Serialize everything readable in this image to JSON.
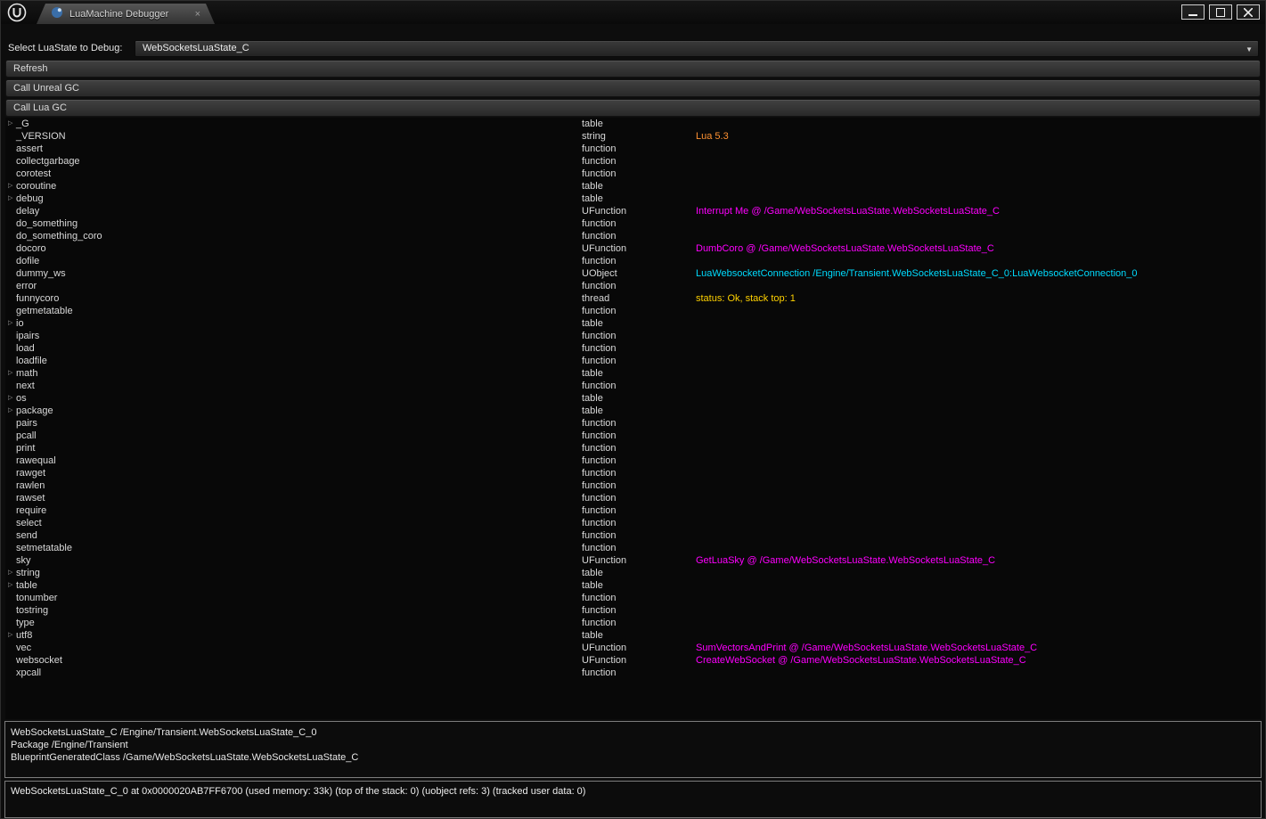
{
  "titlebar": {
    "tab_title": "LuaMachine Debugger"
  },
  "toolbar": {
    "select_label": "Select LuaState to Debug:",
    "selected_state": "WebSocketsLuaState_C",
    "buttons": [
      "Refresh",
      "Call Unreal GC",
      "Call Lua GC"
    ]
  },
  "icons": {
    "expander": "▷",
    "combo_arrow": "▼",
    "tab_close": "×"
  },
  "colors": {
    "string": "#ff9232",
    "ufunction": "#ff00ff",
    "uobject": "#00dcff",
    "thread": "#ffd200"
  },
  "tree": {
    "rows": [
      {
        "name": "_G",
        "type": "table",
        "expand": true
      },
      {
        "name": "_VERSION",
        "type": "string",
        "value": "Lua 5.3",
        "color": "string"
      },
      {
        "name": "assert",
        "type": "function"
      },
      {
        "name": "collectgarbage",
        "type": "function"
      },
      {
        "name": "corotest",
        "type": "function"
      },
      {
        "name": "coroutine",
        "type": "table",
        "expand": true
      },
      {
        "name": "debug",
        "type": "table",
        "expand": true
      },
      {
        "name": "delay",
        "type": "UFunction",
        "value": "Interrupt Me @ /Game/WebSocketsLuaState.WebSocketsLuaState_C",
        "color": "ufunction"
      },
      {
        "name": "do_something",
        "type": "function"
      },
      {
        "name": "do_something_coro",
        "type": "function"
      },
      {
        "name": "docoro",
        "type": "UFunction",
        "value": "DumbCoro @ /Game/WebSocketsLuaState.WebSocketsLuaState_C",
        "color": "ufunction"
      },
      {
        "name": "dofile",
        "type": "function"
      },
      {
        "name": "dummy_ws",
        "type": "UObject",
        "value": "LuaWebsocketConnection /Engine/Transient.WebSocketsLuaState_C_0:LuaWebsocketConnection_0",
        "color": "uobject"
      },
      {
        "name": "error",
        "type": "function"
      },
      {
        "name": "funnycoro",
        "type": "thread",
        "value": "status: Ok, stack top: 1",
        "color": "thread"
      },
      {
        "name": "getmetatable",
        "type": "function"
      },
      {
        "name": "io",
        "type": "table",
        "expand": true
      },
      {
        "name": "ipairs",
        "type": "function"
      },
      {
        "name": "load",
        "type": "function"
      },
      {
        "name": "loadfile",
        "type": "function"
      },
      {
        "name": "math",
        "type": "table",
        "expand": true
      },
      {
        "name": "next",
        "type": "function"
      },
      {
        "name": "os",
        "type": "table",
        "expand": true
      },
      {
        "name": "package",
        "type": "table",
        "expand": true
      },
      {
        "name": "pairs",
        "type": "function"
      },
      {
        "name": "pcall",
        "type": "function"
      },
      {
        "name": "print",
        "type": "function"
      },
      {
        "name": "rawequal",
        "type": "function"
      },
      {
        "name": "rawget",
        "type": "function"
      },
      {
        "name": "rawlen",
        "type": "function"
      },
      {
        "name": "rawset",
        "type": "function"
      },
      {
        "name": "require",
        "type": "function"
      },
      {
        "name": "select",
        "type": "function"
      },
      {
        "name": "send",
        "type": "function"
      },
      {
        "name": "setmetatable",
        "type": "function"
      },
      {
        "name": "sky",
        "type": "UFunction",
        "value": "GetLuaSky @ /Game/WebSocketsLuaState.WebSocketsLuaState_C",
        "color": "ufunction"
      },
      {
        "name": "string",
        "type": "table",
        "expand": true
      },
      {
        "name": "table",
        "type": "table",
        "expand": true
      },
      {
        "name": "tonumber",
        "type": "function"
      },
      {
        "name": "tostring",
        "type": "function"
      },
      {
        "name": "type",
        "type": "function"
      },
      {
        "name": "utf8",
        "type": "table",
        "expand": true
      },
      {
        "name": "vec",
        "type": "UFunction",
        "value": "SumVectorsAndPrint @ /Game/WebSocketsLuaState.WebSocketsLuaState_C",
        "color": "ufunction"
      },
      {
        "name": "websocket",
        "type": "UFunction",
        "value": "CreateWebSocket @ /Game/WebSocketsLuaState.WebSocketsLuaState_C",
        "color": "ufunction"
      },
      {
        "name": "xpcall",
        "type": "function"
      }
    ]
  },
  "detail_panel": {
    "lines": [
      "WebSocketsLuaState_C /Engine/Transient.WebSocketsLuaState_C_0",
      "Package /Engine/Transient",
      "BlueprintGeneratedClass /Game/WebSocketsLuaState.WebSocketsLuaState_C"
    ]
  },
  "status_bar": {
    "text": "WebSocketsLuaState_C_0 at 0x0000020AB7FF6700 (used memory: 33k) (top of the stack: 0) (uobject refs: 3) (tracked user data: 0)"
  }
}
